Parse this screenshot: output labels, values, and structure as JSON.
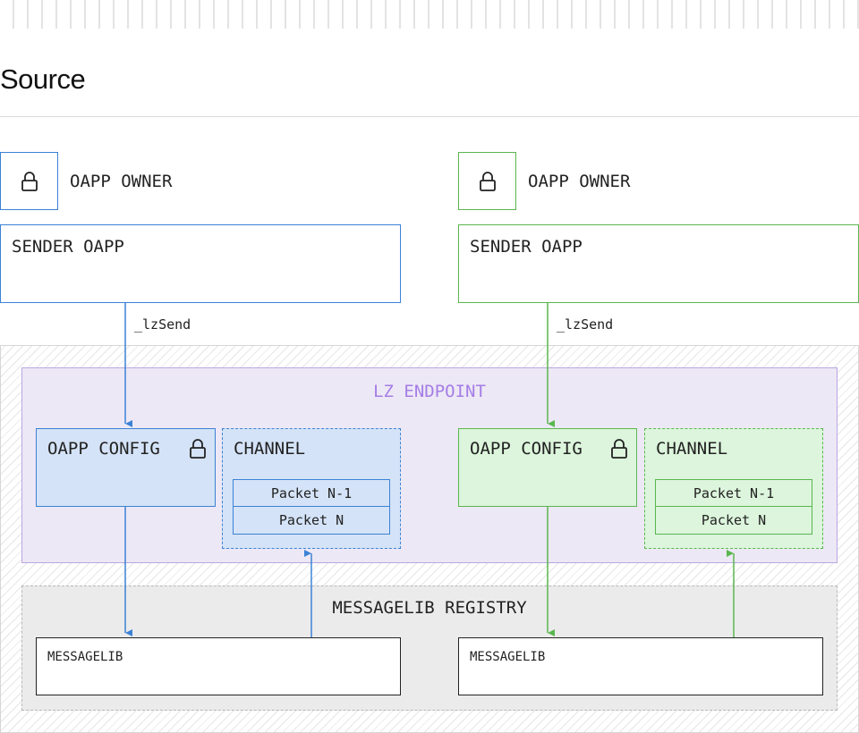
{
  "page": {
    "title": "Source"
  },
  "colors": {
    "blue": "#3b82d6",
    "blue_fill": "#d4e3f7",
    "green": "#5ab64e",
    "green_fill": "#dcf5dc",
    "purple_text": "#a47de6",
    "purple_fill": "#ede8f5"
  },
  "left": {
    "owner_label": "OAPP OWNER",
    "sender_label": "SENDER OAPP",
    "send_call": "_lzSend",
    "config_label": "OAPP CONFIG",
    "channel_label": "CHANNEL",
    "packets": [
      "Packet N-1",
      "Packet N"
    ],
    "messagelib_label": "MESSAGELIB"
  },
  "right": {
    "owner_label": "OAPP OWNER",
    "sender_label": "SENDER OAPP",
    "send_call": "_lzSend",
    "config_label": "OAPP CONFIG",
    "channel_label": "CHANNEL",
    "packets": [
      "Packet N-1",
      "Packet N"
    ],
    "messagelib_label": "MESSAGELIB"
  },
  "endpoint": {
    "label": "LZ ENDPOINT"
  },
  "registry": {
    "label": "MESSAGELIB REGISTRY"
  },
  "icons": {
    "owner_lock": "lock-icon",
    "config_lock": "lock-icon"
  }
}
